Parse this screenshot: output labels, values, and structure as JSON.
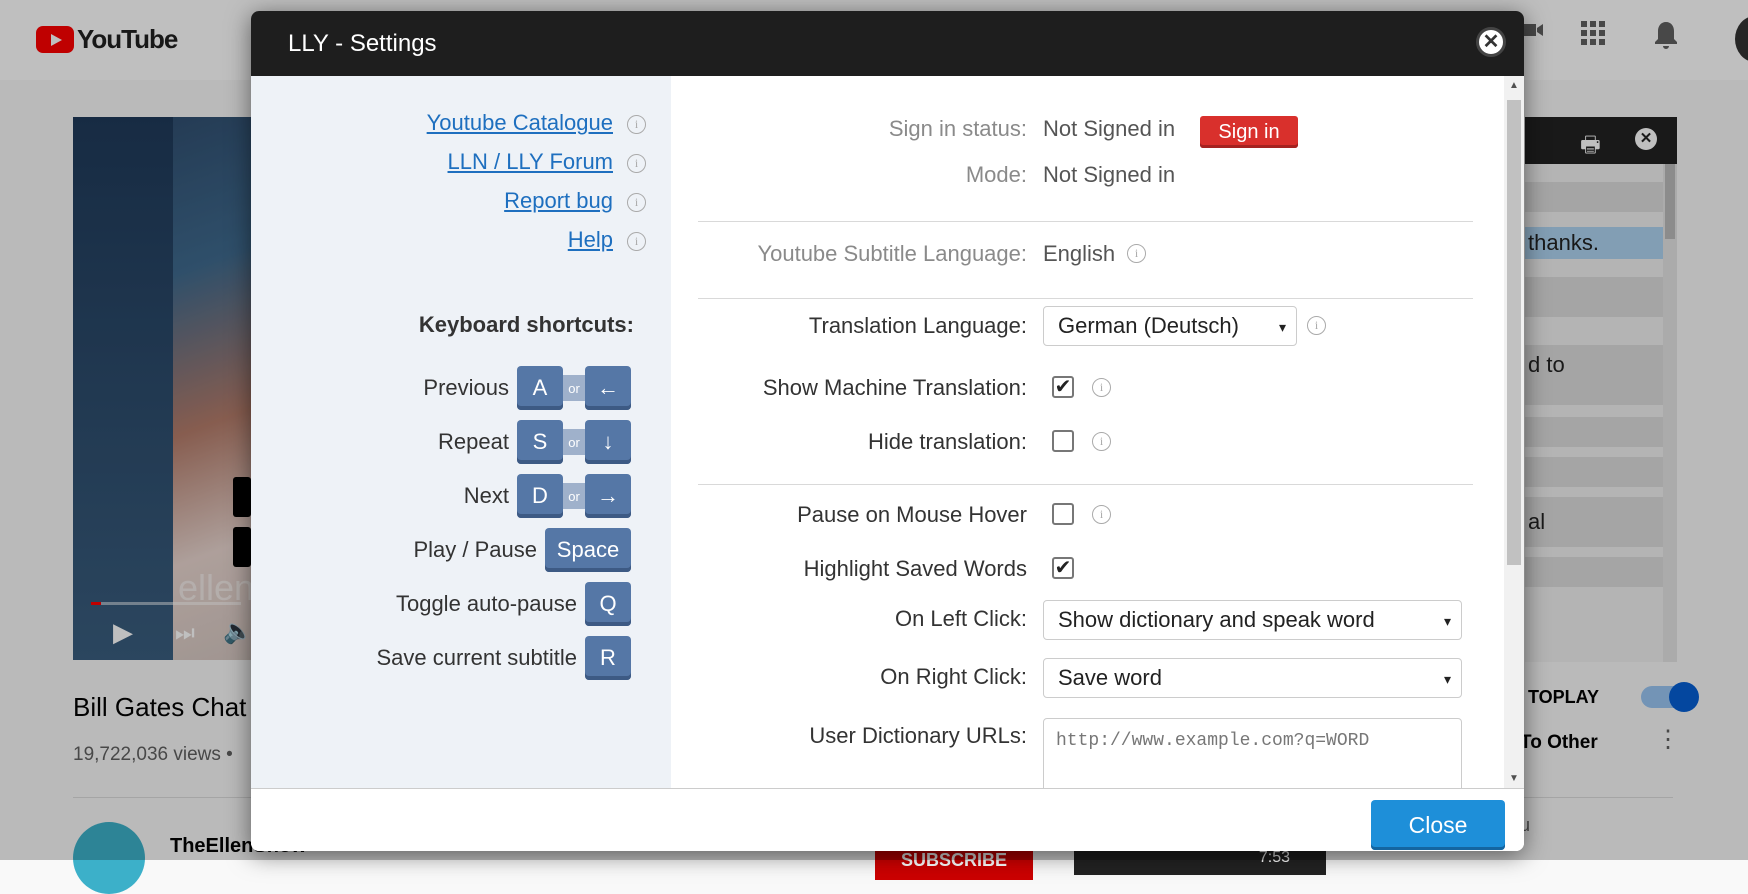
{
  "youtube": {
    "logo_text": "YouTube",
    "video_title": "Bill Gates Chat",
    "views": "19,722,036 views •",
    "channel": "TheEllenShow",
    "autoplay": "TOPLAY",
    "to_other": "To Other",
    "subscribe": "SUBSCRIBE",
    "side_rows": [
      "thanks.",
      "d to",
      "al"
    ],
    "video_watermark": "ellen",
    "duration": "7:53",
    "sidebar_bottom_text": "u"
  },
  "modal": {
    "title": "LLY - Settings",
    "close_label": "Close",
    "links": [
      {
        "label": "Youtube Catalogue"
      },
      {
        "label": "LLN / LLY Forum"
      },
      {
        "label": "Report bug"
      },
      {
        "label": "Help"
      }
    ],
    "shortcuts_title": "Keyboard shortcuts:",
    "or_label": "or",
    "shortcuts": [
      {
        "label": "Previous",
        "key": "A",
        "alt": "←"
      },
      {
        "label": "Repeat",
        "key": "S",
        "alt": "↓"
      },
      {
        "label": "Next",
        "key": "D",
        "alt": "→"
      },
      {
        "label": "Play / Pause",
        "key": "Space"
      },
      {
        "label": "Toggle auto-pause",
        "key": "Q"
      },
      {
        "label": "Save current subtitle",
        "key": "R"
      }
    ],
    "settings": {
      "sign_in_status_label": "Sign in status:",
      "sign_in_status_value": "Not Signed in",
      "sign_in_button": "Sign in",
      "mode_label": "Mode:",
      "mode_value": "Not Signed in",
      "yt_sub_lang_label": "Youtube Subtitle Language:",
      "yt_sub_lang_value": "English",
      "translation_lang_label": "Translation Language:",
      "translation_lang_value": "German (Deutsch)",
      "show_mt_label": "Show Machine Translation:",
      "show_mt_checked": true,
      "hide_translation_label": "Hide translation:",
      "hide_translation_checked": false,
      "pause_hover_label": "Pause on Mouse Hover",
      "pause_hover_checked": false,
      "highlight_saved_label": "Highlight Saved Words",
      "highlight_saved_checked": true,
      "left_click_label": "On Left Click:",
      "left_click_value": "Show dictionary and speak word",
      "right_click_label": "On Right Click:",
      "right_click_value": "Save word",
      "user_dict_label": "User Dictionary URLs:",
      "user_dict_placeholder": "http://www.example.com?q=WORD"
    }
  },
  "colors": {
    "header_bg": "#1e1e1e",
    "left_pane_bg": "#eef2f7",
    "key_bg": "#5577a6",
    "link": "#1e6fbf",
    "signin_btn": "#d9302c",
    "close_btn": "#1e8fd9"
  },
  "icons": {
    "check": "✔",
    "select_arrow": "▾",
    "info": "i",
    "close": "✕"
  }
}
